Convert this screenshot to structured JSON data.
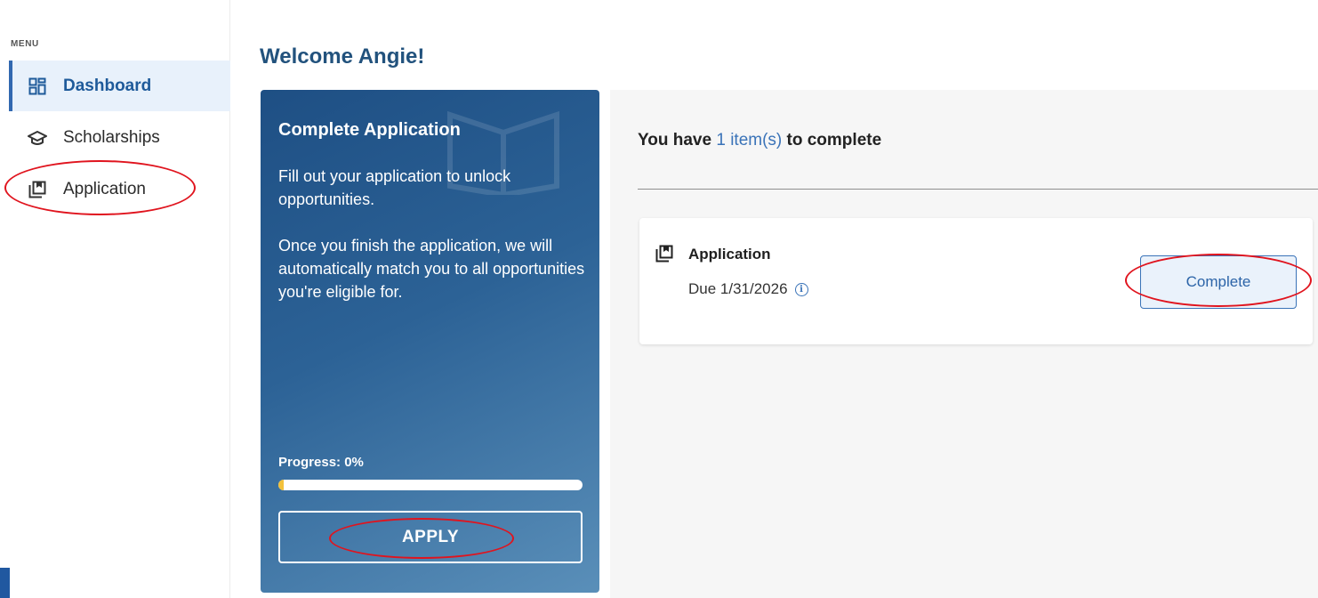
{
  "sidebar": {
    "menu_label": "MENU",
    "items": [
      {
        "label": "Dashboard",
        "icon": "dashboard-icon",
        "active": true
      },
      {
        "label": "Scholarships",
        "icon": "graduation-cap-icon",
        "active": false
      },
      {
        "label": "Application",
        "icon": "application-icon",
        "active": false
      }
    ]
  },
  "main": {
    "title": "Welcome Angie!",
    "promo_card": {
      "title": "Complete Application",
      "text1": "Fill out your application to unlock opportunities.",
      "text2": "Once you finish the application, we will automatically match you to all opportunities you're eligible for.",
      "progress_label": "Progress: 0%",
      "progress_value": 0,
      "apply_label": "APPLY"
    },
    "items_panel": {
      "heading_prefix": "You have ",
      "heading_count": "1 item(s)",
      "heading_suffix": " to complete",
      "task": {
        "title": "Application",
        "due": "Due 1/31/2026",
        "info_glyph": "i",
        "button_label": "Complete"
      }
    }
  },
  "colors": {
    "accent": "#3168b0",
    "heading": "#22527d",
    "promo_gradient_start": "#1e4f84",
    "promo_gradient_end": "#5a8fb9",
    "progress": "#f2c13c",
    "annotation": "#e0141e"
  }
}
